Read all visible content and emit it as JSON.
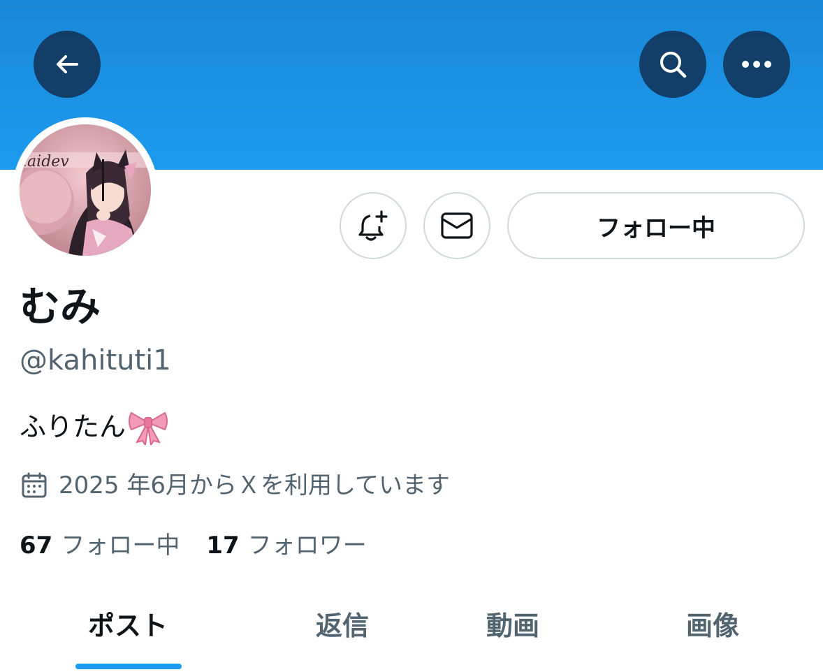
{
  "header": {
    "back_icon": "arrow-left-icon",
    "search_icon": "search-icon",
    "more_icon": "more-horizontal-icon",
    "banner_color": "#1d9bf0"
  },
  "profile": {
    "display_name": "むみ",
    "handle": "@kahituti1",
    "bio": "ふりたん",
    "bio_emoji": "ribbon-bow-icon",
    "joined": "2025 年6月からＸを利用しています",
    "joined_icon": "calendar-icon"
  },
  "actions": {
    "notify_icon": "bell-plus-icon",
    "message_icon": "mail-icon",
    "follow_label": "フォロー中"
  },
  "stats": {
    "following_count": "67",
    "following_label": "フォロー中",
    "followers_count": "17",
    "followers_label": "フォロワー"
  },
  "tabs": [
    {
      "label": "ポスト",
      "active": true
    },
    {
      "label": "返信",
      "active": false
    },
    {
      "label": "動画",
      "active": false
    },
    {
      "label": "画像",
      "active": false
    }
  ],
  "colors": {
    "accent": "#1d9bf0",
    "text_primary": "#0f1419",
    "text_secondary": "#536471",
    "border": "#cfd9de"
  }
}
